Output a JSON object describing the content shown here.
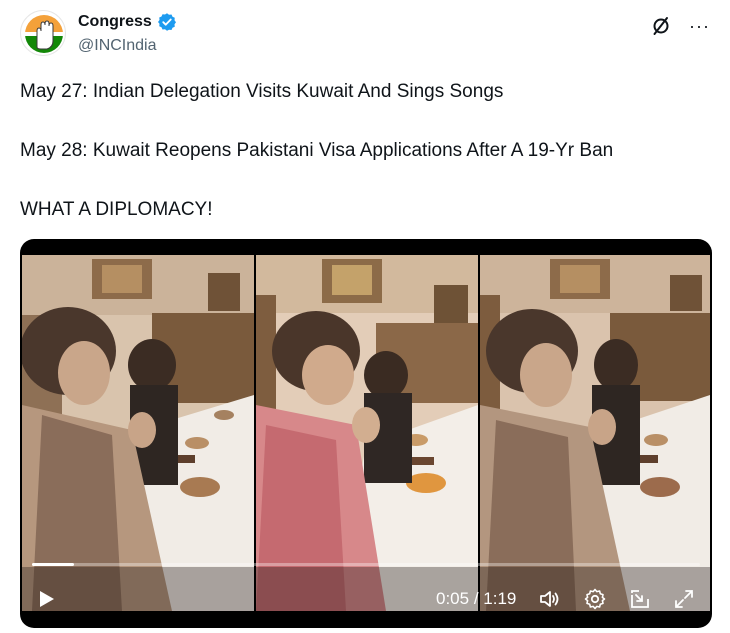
{
  "tweet": {
    "author": {
      "display_name": "Congress",
      "handle": "@INCIndia",
      "verified": true,
      "avatar_icon": "congress-hand-logo"
    },
    "lines": [
      "May 27: Indian Delegation Visits Kuwait And Sings Songs",
      "May 28: Kuwait Reopens Pakistani Visa Applications After A 19-Yr Ban",
      "WHAT A DIPLOMACY!"
    ],
    "actions": {
      "grok_icon": "grok-icon",
      "more_label": "···"
    }
  },
  "video": {
    "current_time": "0:05",
    "duration": "1:19",
    "time_separator": " / ",
    "progress": 0.063,
    "icons": [
      "play-icon",
      "volume-icon",
      "gear-icon",
      "picture-in-picture-icon",
      "fullscreen-icon"
    ]
  },
  "colors": {
    "verified_blue": "#1d9bf0",
    "logo_saffron": "#f4a13a",
    "logo_green": "#138808",
    "text_primary": "#0f1419",
    "text_secondary": "#536471"
  }
}
